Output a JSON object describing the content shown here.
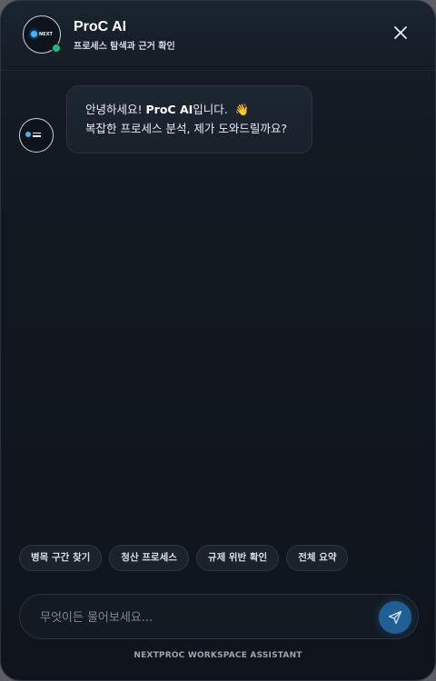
{
  "header": {
    "avatar_logo_text": "NEXT",
    "title": "ProC AI",
    "subtitle": "프로세스 탐색과 근거 확인",
    "icons": {
      "close": "close-icon",
      "status": "online-status-dot"
    },
    "status_color": "#1fb97a"
  },
  "chat": {
    "messages": [
      {
        "role": "assistant",
        "line1_prefix": "안녕하세요! ",
        "line1_strong": "ProC AI",
        "line1_suffix": "입니다.",
        "emoji": "👋",
        "line2": "복잡한 프로세스 분석, 제가 도와드릴까요?"
      }
    ]
  },
  "quick_actions": [
    {
      "label": "병목 구간 찾기"
    },
    {
      "label": "청산 프로세스"
    },
    {
      "label": "규제 위반 확인"
    },
    {
      "label": "전체 요약"
    }
  ],
  "composer": {
    "placeholder": "무엇이든 물어보세요...",
    "value": "",
    "send_icon": "send-icon",
    "accent_color": "#1f5f95"
  },
  "footer": {
    "text": "NEXTPROC WORKSPACE ASSISTANT"
  }
}
